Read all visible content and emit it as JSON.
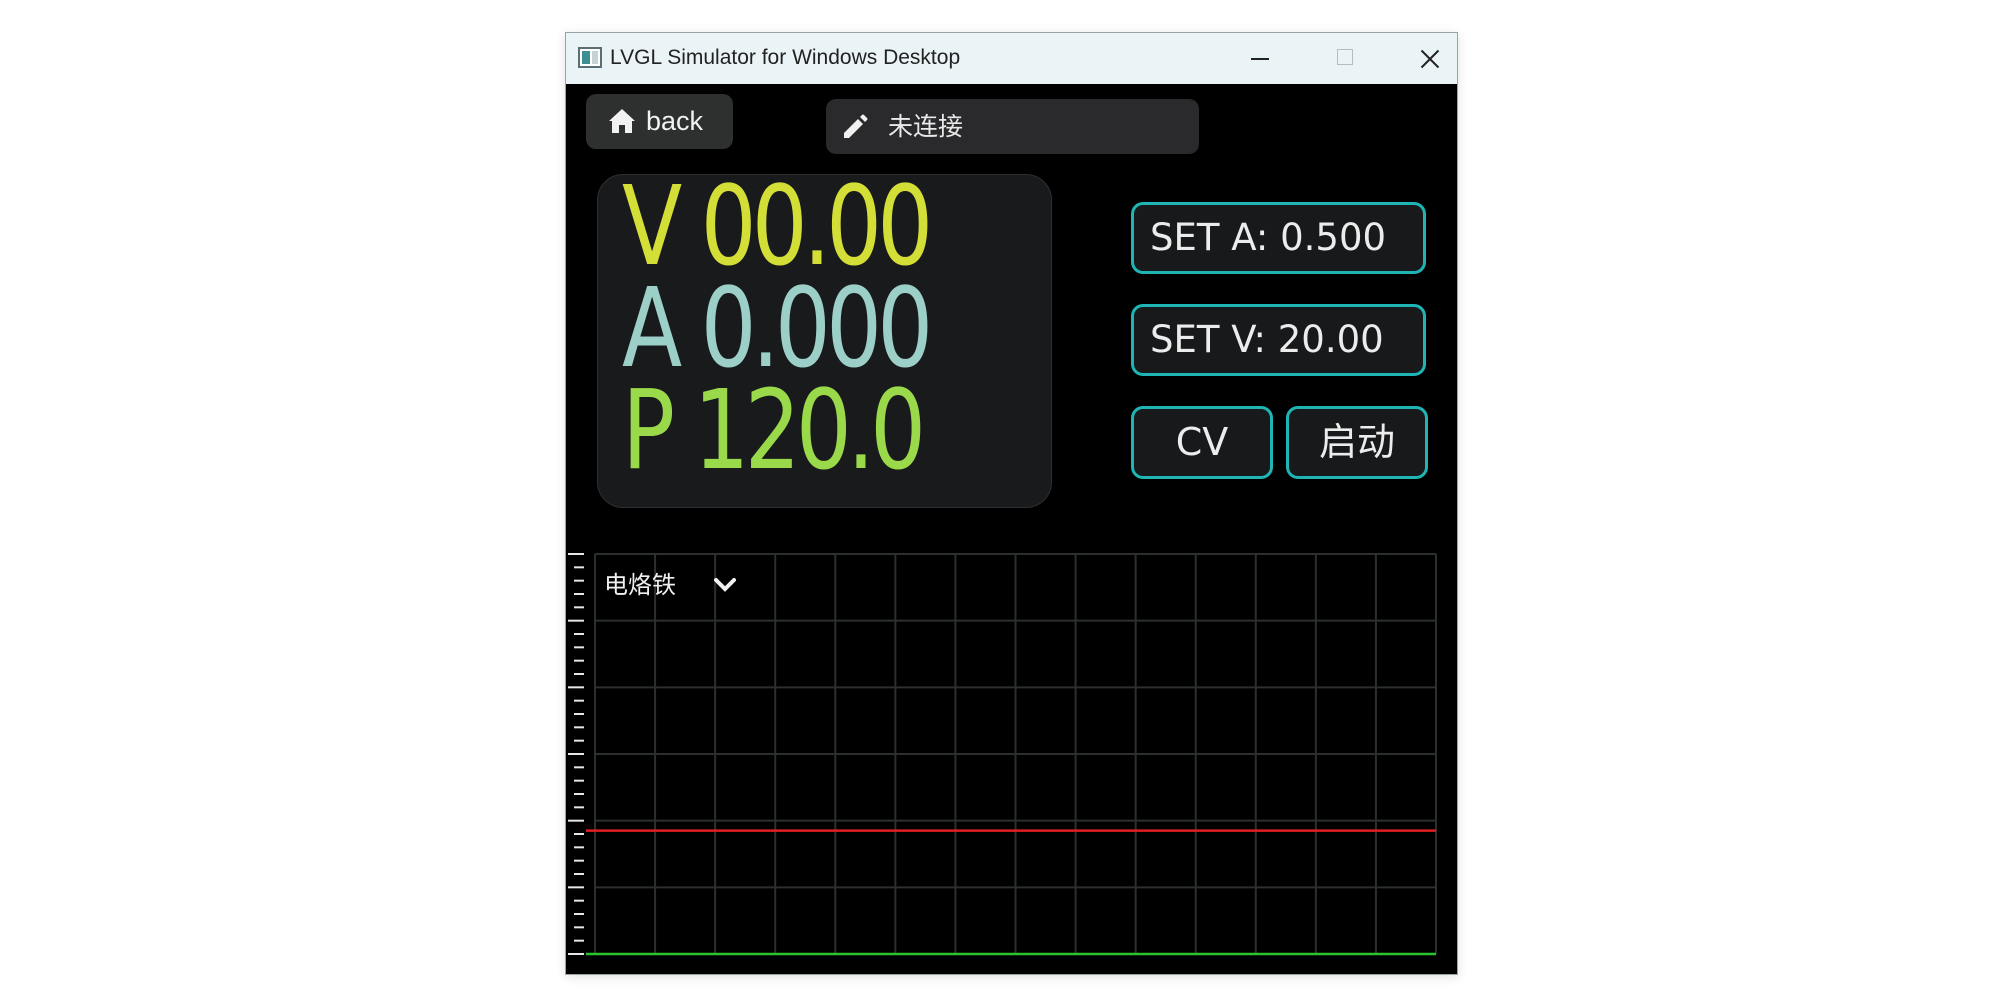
{
  "window": {
    "title": "LVGL Simulator for Windows Desktop"
  },
  "toolbar": {
    "back_label": "back",
    "back_icon": "home-icon",
    "status_icon": "pencil-icon",
    "status_label": "未连接"
  },
  "readout": {
    "voltage": "V 00.00",
    "current": "A 0.000",
    "power": "P 120.0",
    "colors": {
      "voltage": "#d3de37",
      "current": "#9bcfc7",
      "power": "#9ad94a"
    }
  },
  "controls": {
    "set_current": "SET A: 0.500",
    "set_voltage": "SET V: 20.00",
    "mode": "CV",
    "start": "启动",
    "accent": "#1fb5b5"
  },
  "chart": {
    "preset_selected": "电烙铁"
  },
  "chart_data": {
    "type": "line",
    "title": "",
    "xlabel": "",
    "ylabel": "",
    "grid": true,
    "ylim": [
      0,
      6
    ],
    "x_divisions": 14,
    "series": [
      {
        "color": "#e02020",
        "values": [
          1.85,
          1.85
        ]
      },
      {
        "color": "#29c42e",
        "values": [
          0,
          0
        ]
      }
    ]
  }
}
